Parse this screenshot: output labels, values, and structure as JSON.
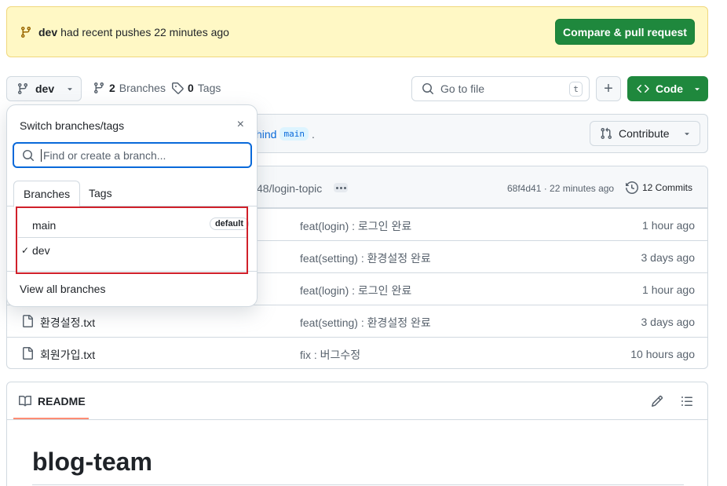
{
  "banner": {
    "branch": "dev",
    "text": "had recent pushes 22 minutes ago",
    "button_label": "Compare & pull request"
  },
  "toolbar": {
    "current_branch": "dev",
    "branches_count": "2",
    "branches_label": "Branches",
    "tags_count": "0",
    "tags_label": "Tags",
    "goto_placeholder": "Go to file",
    "goto_shortcut": "t",
    "add_label": "+",
    "code_label": "Code"
  },
  "info_bar": {
    "text_fragment": "hind",
    "branch_pill": "main",
    "trailing": ".",
    "contribute_label": "Contribute"
  },
  "commit_header": {
    "message_fragment": "48/login-topic",
    "hash_time": "68f4d41 · 22 minutes ago",
    "commits_label": "12 Commits"
  },
  "files": [
    {
      "name": "",
      "message": "feat(login) : 로그인 완료",
      "time": "1 hour ago"
    },
    {
      "name": "",
      "message": "feat(setting) : 환경설정 완료",
      "time": "3 days ago"
    },
    {
      "name": "",
      "message": "feat(login) : 로그인 완료",
      "time": "1 hour ago"
    },
    {
      "name": "환경설정.txt",
      "message": "feat(setting) : 환경설정 완료",
      "time": "3 days ago"
    },
    {
      "name": "회원가입.txt",
      "message": "fix : 버그수정",
      "time": "10 hours ago"
    }
  ],
  "readme": {
    "tab_label": "README",
    "title": "blog-team"
  },
  "dropdown": {
    "title": "Switch branches/tags",
    "close": "×",
    "search_placeholder": "Find or create a branch...",
    "tabs": [
      "Branches",
      "Tags"
    ],
    "branches": [
      {
        "name": "main",
        "badge": "default",
        "checked": false
      },
      {
        "name": "dev",
        "badge": "",
        "checked": true
      }
    ],
    "check_mark": "✓",
    "footer_link": "View all branches"
  },
  "colors": {
    "green": "#1f883d",
    "banner_bg": "#fff8c5",
    "highlight": "#d0202a",
    "focus_blue": "#0969da"
  }
}
